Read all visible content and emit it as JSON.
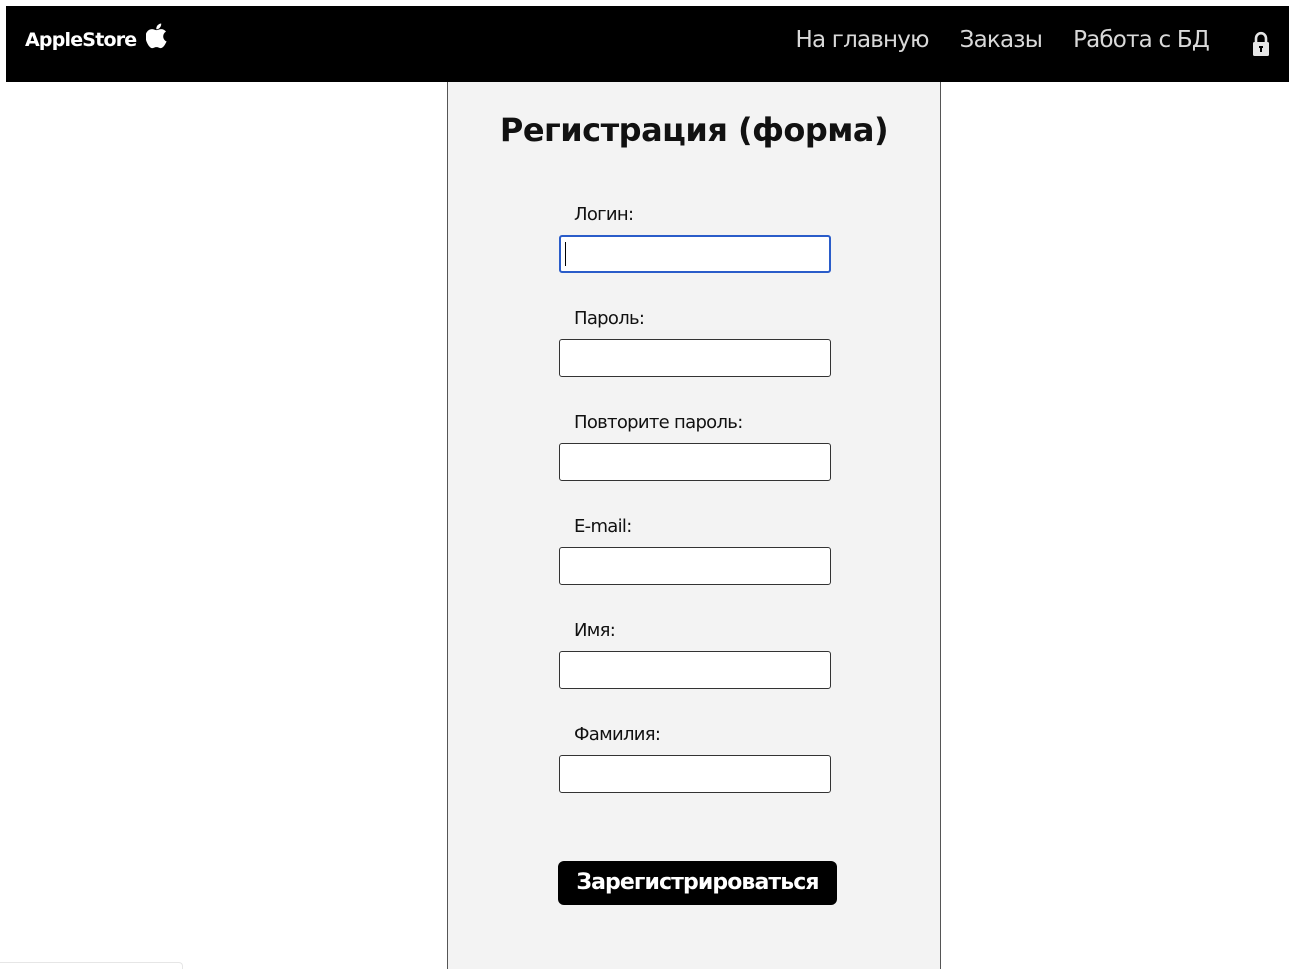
{
  "navbar": {
    "brand": "AppleStore",
    "brand_icon": "apple-logo-icon",
    "links": [
      {
        "label": "На главную"
      },
      {
        "label": "Заказы"
      },
      {
        "label": "Работа с БД"
      }
    ],
    "lock_icon": "lock-icon",
    "background": "#000000",
    "link_color": "#d9d9d9"
  },
  "form": {
    "title": "Регистрация (форма)",
    "fields": [
      {
        "label": "Логин:",
        "value": "",
        "focused": true
      },
      {
        "label": "Пароль:",
        "value": ""
      },
      {
        "label": "Повторите пароль:",
        "value": ""
      },
      {
        "label": "E-mail:",
        "value": ""
      },
      {
        "label": "Имя:",
        "value": ""
      },
      {
        "label": "Фамилия:",
        "value": ""
      }
    ],
    "submit_label": "Зарегистрироваться",
    "panel_background": "#f3f3f3",
    "focus_color": "#2a5cc9"
  }
}
